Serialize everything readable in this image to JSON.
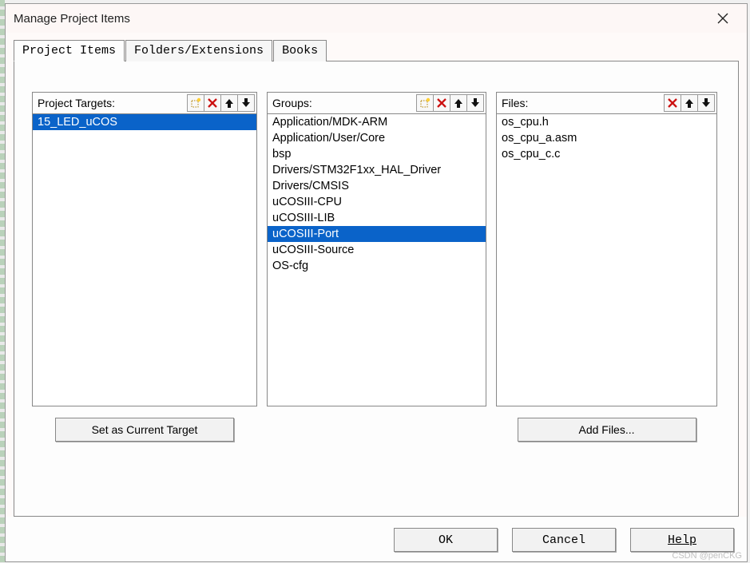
{
  "title": "Manage Project Items",
  "tabs": [
    {
      "label": "Project Items",
      "active": true
    },
    {
      "label": "Folders/Extensions",
      "active": false
    },
    {
      "label": "Books",
      "active": false
    }
  ],
  "columns": {
    "targets": {
      "label": "Project Targets:",
      "toolbar": [
        "new",
        "delete",
        "up",
        "down"
      ],
      "items": [
        "15_LED_uCOS"
      ],
      "selected_index": 0,
      "under_button": "Set as Current Target"
    },
    "groups": {
      "label": "Groups:",
      "toolbar": [
        "new",
        "delete",
        "up",
        "down"
      ],
      "items": [
        "Application/MDK-ARM",
        "Application/User/Core",
        "bsp",
        "Drivers/STM32F1xx_HAL_Driver",
        "Drivers/CMSIS",
        "uCOSIII-CPU",
        "uCOSIII-LIB",
        "uCOSIII-Port",
        "uCOSIII-Source",
        "OS-cfg"
      ],
      "selected_index": 7
    },
    "files": {
      "label": "Files:",
      "toolbar": [
        "delete",
        "up",
        "down"
      ],
      "items": [
        "os_cpu.h",
        "os_cpu_a.asm",
        "os_cpu_c.c"
      ],
      "selected_index": -1,
      "under_button": "Add Files..."
    }
  },
  "buttons": {
    "ok": "OK",
    "cancel": "Cancel",
    "help": "Help"
  },
  "watermark": "CSDN @penCKG"
}
